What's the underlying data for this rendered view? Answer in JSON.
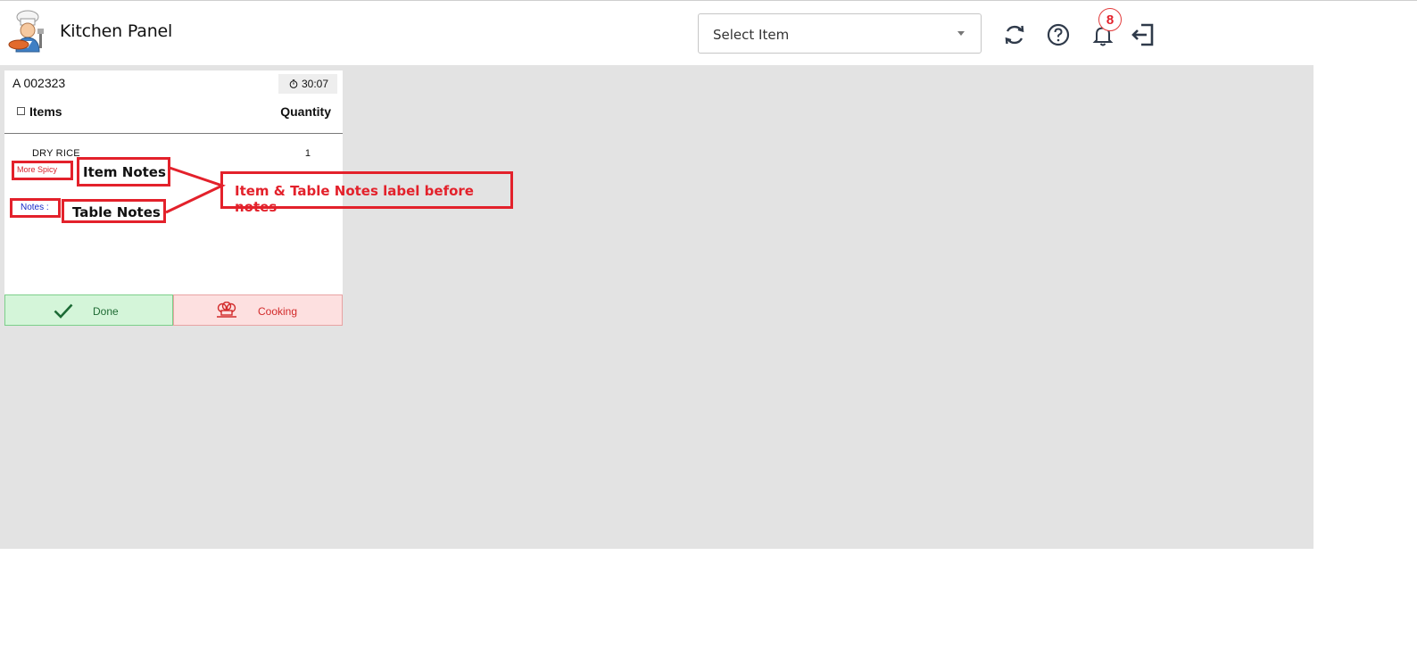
{
  "header": {
    "title": "Kitchen Panel",
    "select_value": "Select Item",
    "notification_count": "8",
    "icons": [
      "chef-logo",
      "refresh-icon",
      "help-icon",
      "bell-icon",
      "logout-icon"
    ]
  },
  "order": {
    "number": "A 002323",
    "timer": "30:07",
    "columns": {
      "items": "Items",
      "quantity": "Quantity"
    },
    "items": [
      {
        "name": "DRY RICE",
        "qty": "1",
        "note": "More Spicy"
      }
    ],
    "table_notes_label": "Notes :",
    "actions": {
      "done": "Done",
      "cooking": "Cooking"
    }
  },
  "annotations": {
    "item_notes": "Item Notes",
    "table_notes": "Table Notes",
    "callout": "Item & Table Notes label before notes"
  },
  "colors": {
    "accent_red": "#e3212b",
    "note_red": "#d9232c",
    "note_blue": "#1428c8",
    "done_bg": "#d4f5d9",
    "cooking_bg": "#fde0e0",
    "panel_gray": "#e3e3e3"
  }
}
